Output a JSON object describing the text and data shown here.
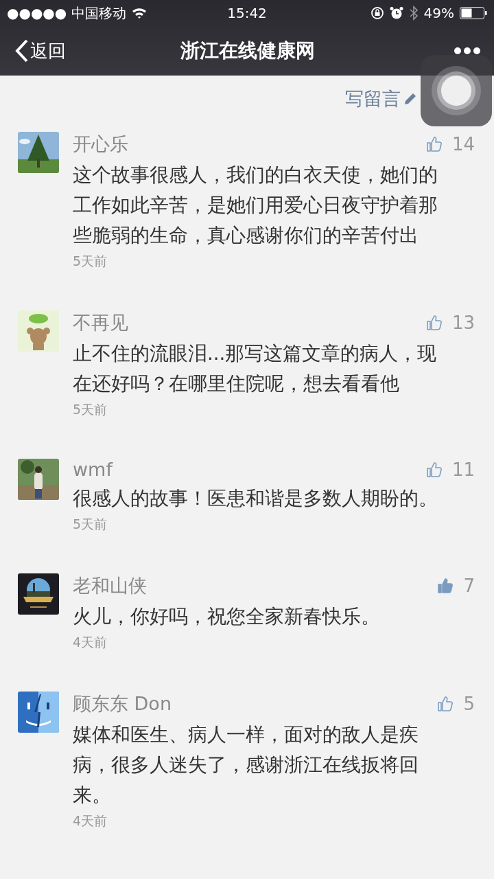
{
  "status_bar": {
    "carrier": "●●●●● 中国移动",
    "time": "15:42",
    "battery": "49%"
  },
  "nav_bar": {
    "back": "返回",
    "title": "浙江在线健康网"
  },
  "write_comment": "写留言",
  "comments": [
    {
      "name": "开心乐",
      "likes": "14",
      "liked": false,
      "text": "这个故事很感人，我们的白衣天使，她们的工作如此辛苦，是她们用爱心日夜守护着那些脆弱的生命，真心感谢你们的辛苦付出",
      "time": "5天前"
    },
    {
      "name": "不再见",
      "likes": "13",
      "liked": false,
      "text": "止不住的流眼泪...那写这篇文章的病人，现在还好吗？在哪里住院呢，想去看看他",
      "time": "5天前"
    },
    {
      "name": "wmf",
      "likes": "11",
      "liked": false,
      "text": "很感人的故事！医患和谐是多数人期盼的。",
      "time": "5天前"
    },
    {
      "name": "老和山侠",
      "likes": "7",
      "liked": true,
      "text": "火儿，你好吗，祝您全家新春快乐。",
      "time": "4天前"
    },
    {
      "name": "顾东东 Don",
      "likes": "5",
      "liked": false,
      "text": "媒体和医生、病人一样，面对的敌人是疾病，很多人迷失了，感谢浙江在线扳将回来。",
      "time": "4天前"
    }
  ]
}
